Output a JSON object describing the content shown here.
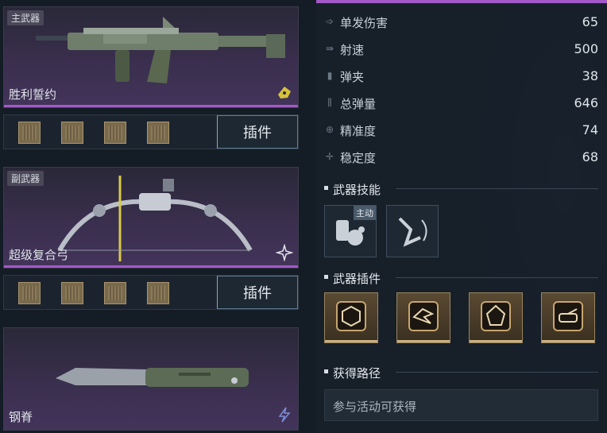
{
  "weapons": {
    "primary": {
      "tag": "主武器",
      "name": "胜利誓约",
      "plugin_label": "插件"
    },
    "secondary": {
      "tag": "副武器",
      "name": "超级复合弓",
      "plugin_label": "插件"
    },
    "melee": {
      "name": "钢脊"
    }
  },
  "stats": [
    {
      "label": "单发伤害",
      "value": "65",
      "icon": "damage-icon"
    },
    {
      "label": "射速",
      "value": "500",
      "icon": "firerate-icon"
    },
    {
      "label": "弹夹",
      "value": "38",
      "icon": "magazine-icon"
    },
    {
      "label": "总弹量",
      "value": "646",
      "icon": "ammo-icon"
    },
    {
      "label": "精准度",
      "value": "74",
      "icon": "crosshair-icon"
    },
    {
      "label": "稳定度",
      "value": "68",
      "icon": "stability-icon"
    }
  ],
  "sections": {
    "skills": "武器技能",
    "plugins": "武器插件",
    "acquire": "获得路径"
  },
  "skills": [
    {
      "badge": "主动",
      "icon": "grenade-skill-icon"
    },
    {
      "icon": "grapple-skill-icon"
    }
  ],
  "plugins_icons": [
    "hex-gear-plugin-icon",
    "bird-plugin-icon",
    "shield-plugin-icon",
    "tank-plugin-icon"
  ],
  "acquire_text": "参与活动可获得",
  "colors": {
    "accent": "#a259c7",
    "gold": "#c7a56e"
  }
}
